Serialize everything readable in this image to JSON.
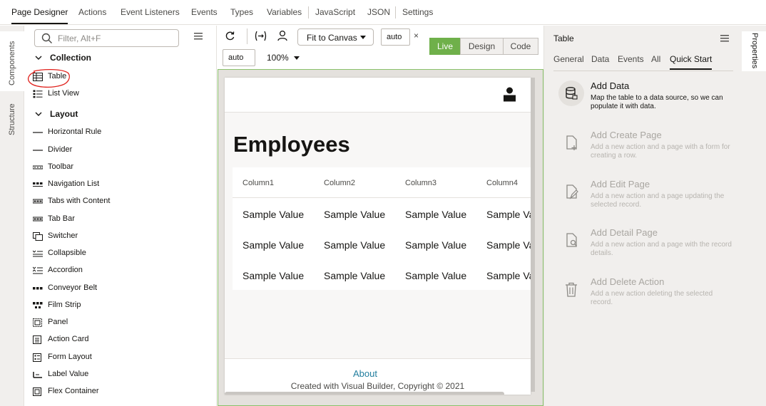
{
  "topnav": {
    "tabs": [
      "Page Designer",
      "Actions",
      "Event Listeners",
      "Events",
      "Types",
      "Variables",
      "JavaScript",
      "JSON",
      "Settings"
    ]
  },
  "lefttabs": {
    "components": "Components",
    "structure": "Structure"
  },
  "leftpanel": {
    "search_placeholder": "Filter, Alt+F",
    "sections": {
      "collection": "Collection",
      "layout": "Layout"
    },
    "collection_items": [
      "Table",
      "List View"
    ],
    "layout_items": [
      "Horizontal Rule",
      "Divider",
      "Toolbar",
      "Navigation List",
      "Tabs with Content",
      "Tab Bar",
      "Switcher",
      "Collapsible",
      "Accordion",
      "Conveyor Belt",
      "Film Strip",
      "Panel",
      "Action Card",
      "Form Layout",
      "Label Value",
      "Flex Container"
    ]
  },
  "toolbar": {
    "fit_label": "Fit to Canvas",
    "width_value": "auto",
    "height_value": "auto",
    "zoom": "100%",
    "close_glyph": "×",
    "modes": [
      "Live",
      "Design",
      "Code"
    ]
  },
  "canvas": {
    "heading": "Employees",
    "columns": [
      "Column1",
      "Column2",
      "Column3",
      "Column4"
    ],
    "rows": [
      [
        "Sample Value",
        "Sample Value",
        "Sample Value",
        "Sample Va"
      ],
      [
        "Sample Value",
        "Sample Value",
        "Sample Value",
        "Sample Va"
      ],
      [
        "Sample Value",
        "Sample Value",
        "Sample Value",
        "Sample Va"
      ]
    ],
    "footer_link": "About",
    "footer_text": "Created with Visual Builder, Copyright © 2021"
  },
  "rightpanel": {
    "title": "Table",
    "tabs": [
      "General",
      "Data",
      "Events",
      "All",
      "Quick Start"
    ],
    "quickstart": [
      {
        "title": "Add Data",
        "desc": "Map the table to a data source, so we can populate it with data.",
        "icon": "database-icon"
      },
      {
        "title": "Add Create Page",
        "desc": "Add a new action and a page with a form for creating a row.",
        "icon": "create-page-icon"
      },
      {
        "title": "Add Edit Page",
        "desc": "Add a new action and a page updating the selected record.",
        "icon": "edit-page-icon"
      },
      {
        "title": "Add Detail Page",
        "desc": "Add a new action and a page with the record details.",
        "icon": "detail-page-icon"
      },
      {
        "title": "Add Delete Action",
        "desc": "Add a new action deleting the selected record.",
        "icon": "trash-icon"
      }
    ]
  },
  "righttabs": {
    "properties": "Properties"
  },
  "colors": {
    "live_green": "#6fb04a",
    "link": "#227e9e",
    "annotation_red": "#e0201b"
  }
}
